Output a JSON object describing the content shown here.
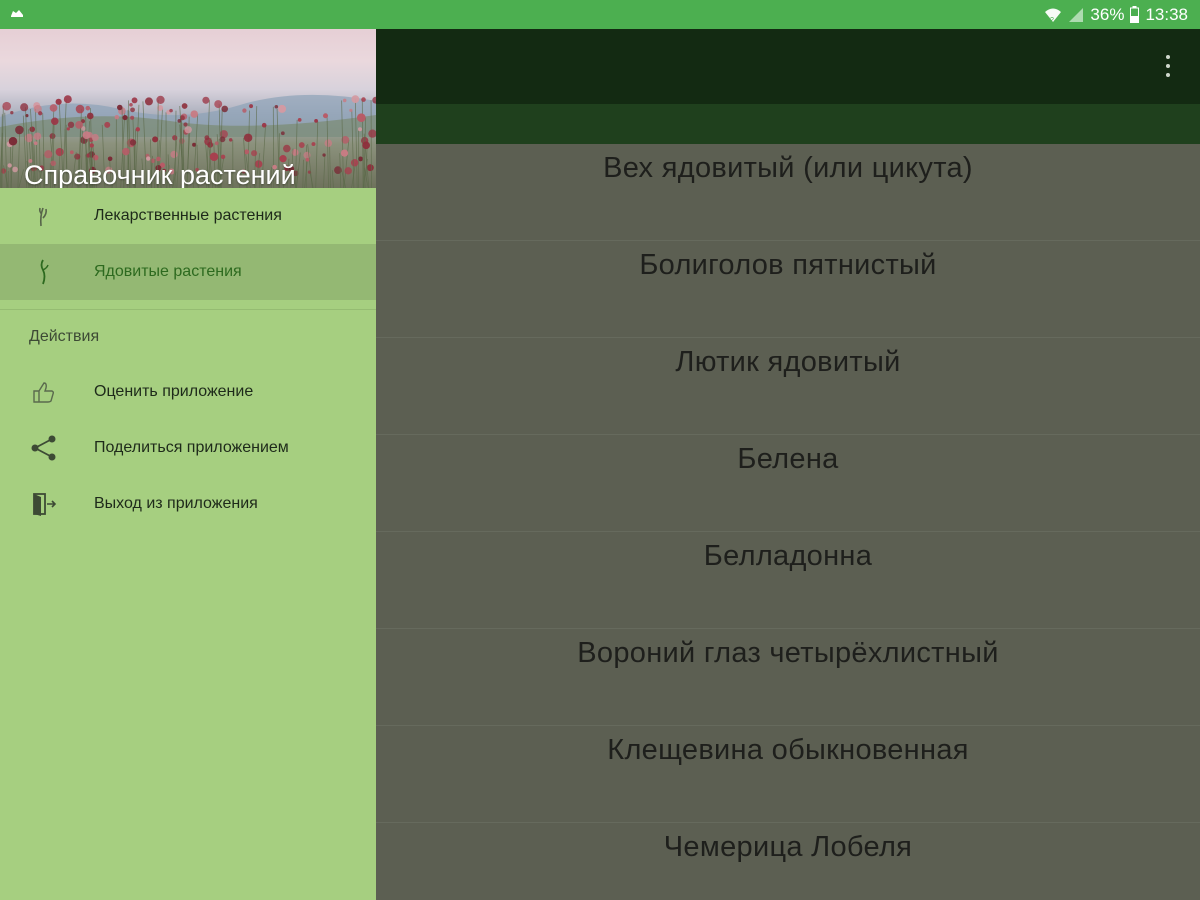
{
  "status_bar": {
    "battery": "36%",
    "time": "13:38",
    "icons": [
      "app-notification-icon",
      "wifi-icon",
      "signal-icon",
      "battery-icon"
    ]
  },
  "drawer": {
    "title": "Справочник растений",
    "items": [
      {
        "label": "Лекарственные растения",
        "icon": "herb-icon",
        "selected": false
      },
      {
        "label": "Ядовитые растения",
        "icon": "plant-sprout-icon",
        "selected": true
      }
    ],
    "section_title": "Действия",
    "actions": [
      {
        "label": "Оценить приложение",
        "icon": "thumb-up-icon"
      },
      {
        "label": "Поделиться приложением",
        "icon": "share-icon"
      },
      {
        "label": "Выход из приложения",
        "icon": "exit-icon"
      }
    ]
  },
  "toolbar": {
    "overflow_icon": "more-vert-icon"
  },
  "plants": [
    "Вех ядовитый (или цикута)",
    "Болиголов пятнистый",
    "Лютик ядовитый",
    "Белена",
    "Белладонна",
    "Вороний глаз четырёхлистный",
    "Клещевина обыкновенная",
    "Чемерица Лобеля"
  ],
  "colors": {
    "status_bar": "#4caf50",
    "drawer_bg": "#a6cf80",
    "drawer_selected": "#94b873",
    "toolbar": "#132a12",
    "tab_strip": "#1f401d",
    "scrim_content": "#5c5f52"
  }
}
